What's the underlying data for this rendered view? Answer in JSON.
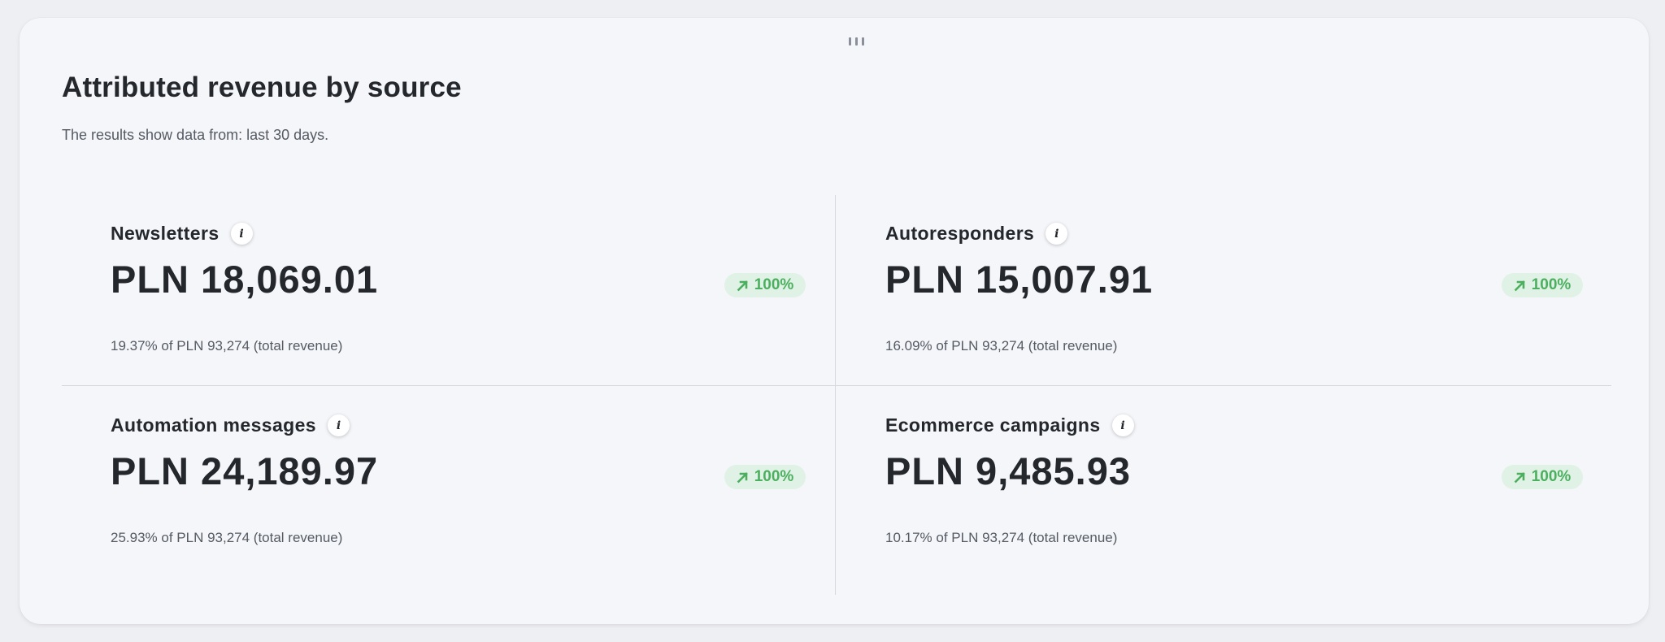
{
  "header": {
    "title": "Attributed revenue by source",
    "subtitle": "The results show data from: last 30 days."
  },
  "tiles": [
    {
      "name": "Newsletters",
      "value": "PLN 18,069.01",
      "change": "100%",
      "description": "19.37% of PLN 93,274 (total revenue)"
    },
    {
      "name": "Autoresponders",
      "value": "PLN 15,007.91",
      "change": "100%",
      "description": "16.09% of PLN 93,274 (total revenue)"
    },
    {
      "name": "Automation messages",
      "value": "PLN 24,189.97",
      "change": "100%",
      "description": "25.93% of PLN 93,274 (total revenue)"
    },
    {
      "name": "Ecommerce campaigns",
      "value": "PLN 9,485.93",
      "change": "100%",
      "description": "10.17% of PLN 93,274 (total revenue)"
    }
  ],
  "icons": {
    "info": "info-icon",
    "trend": "arrow-up-right-icon",
    "drag": "drag-handle-icon"
  },
  "colors": {
    "trend_positive": "#4caf60",
    "trend_badge_bg": "#e0f2e5",
    "text_primary": "#24272c",
    "text_secondary": "#555a63"
  }
}
